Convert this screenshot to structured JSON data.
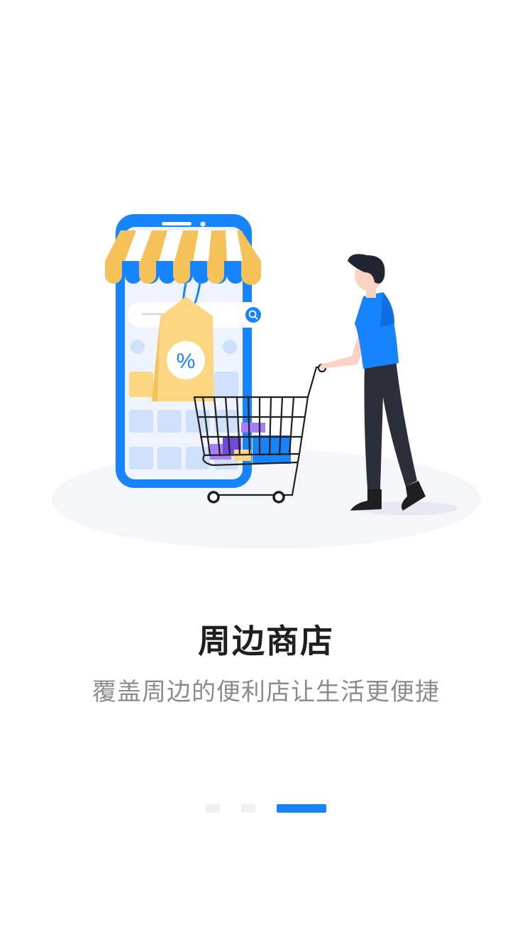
{
  "onboarding": {
    "title": "周边商店",
    "subtitle": "覆盖周边的便利店让生活更便捷",
    "tag_symbol": "%",
    "page_indicator": {
      "total": 3,
      "current": 3
    }
  },
  "colors": {
    "accent": "#1684fc",
    "awning_yellow": "#f5c25a",
    "tag_yellow": "#fcd782",
    "dark_pants": "#2b2f3a"
  },
  "icons": [
    "search-icon"
  ]
}
